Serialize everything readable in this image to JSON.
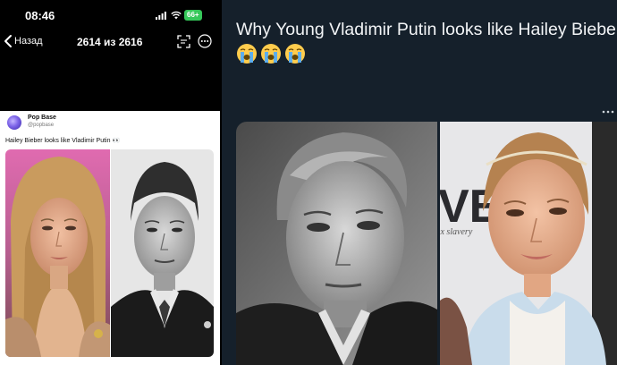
{
  "phone": {
    "status": {
      "time": "08:46",
      "battery": "66+"
    },
    "nav": {
      "back_label": "Назад",
      "counter": "2614 из 2616"
    },
    "post": {
      "author_name": "Pop Base",
      "author_handle": "@popbase",
      "text": "Hailey Bieber looks like Vladimir Putin 👀"
    }
  },
  "tweet": {
    "text": "Why Young Vladimir Putin looks like Hailey Bieber",
    "emojis": [
      "😭",
      "😭",
      "😭"
    ],
    "backdrop_text": {
      "big": "VE",
      "small": "ex slavery"
    }
  },
  "colors": {
    "twitter_dark": "#15202b",
    "battery_green": "#35c759",
    "phone_bg": "#000000"
  },
  "icons": [
    "signal-icon",
    "wifi-icon",
    "back-chevron-icon",
    "scan-icon",
    "more-icon",
    "cry-emoji-icon",
    "more-horizontal-icon"
  ]
}
